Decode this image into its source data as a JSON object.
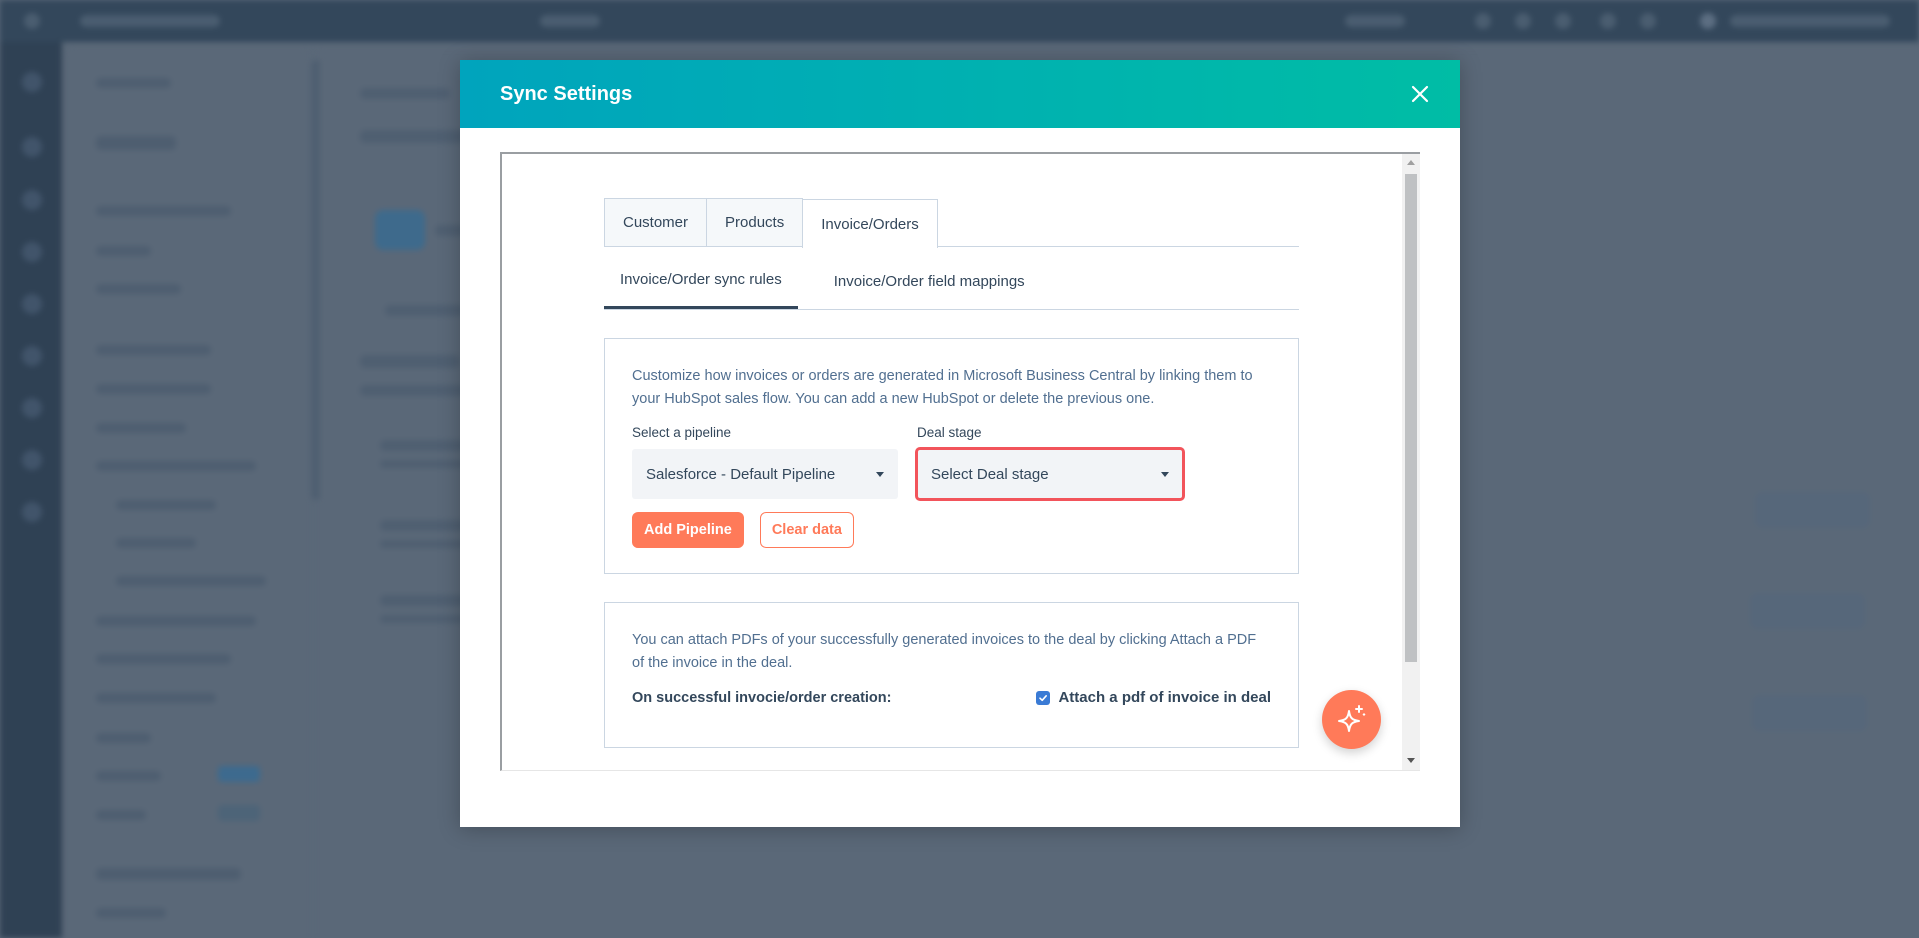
{
  "modal": {
    "title": "Sync Settings",
    "close_icon": "close-icon"
  },
  "tabs": [
    {
      "label": "Customer",
      "active": false
    },
    {
      "label": "Products",
      "active": false
    },
    {
      "label": "Invoice/Orders",
      "active": true
    }
  ],
  "subtabs": [
    {
      "label": "Invoice/Order sync rules",
      "active": true
    },
    {
      "label": "Invoice/Order field mappings",
      "active": false
    }
  ],
  "pipeline_card": {
    "description": "Customize how invoices or orders are generated in Microsoft Business Central by linking them to your HubSpot sales flow. You can add a new HubSpot or delete the previous one.",
    "pipeline_label": "Select a pipeline",
    "pipeline_value": "Salesforce - Default Pipeline",
    "deal_stage_label": "Deal stage",
    "deal_stage_placeholder": "Select Deal stage",
    "add_pipeline_label": "Add Pipeline",
    "clear_data_label": "Clear data"
  },
  "attach_card": {
    "description": "You can attach PDFs of your successfully generated invoices to the deal by clicking Attach a PDF of the invoice in the deal.",
    "creation_label": "On successful invocie/order creation:",
    "checkbox_label": "Attach a pdf of invoice in deal",
    "checkbox_checked": true
  },
  "fab": {
    "icon": "sparkle-icon"
  },
  "colors": {
    "header_gradient_start": "#00a4bd",
    "header_gradient_end": "#00bda5",
    "accent": "#ff7a59",
    "highlight_border": "#f2545b",
    "checkbox": "#3a7bd5",
    "text": "#33475b",
    "overlay": "#5a6878"
  }
}
